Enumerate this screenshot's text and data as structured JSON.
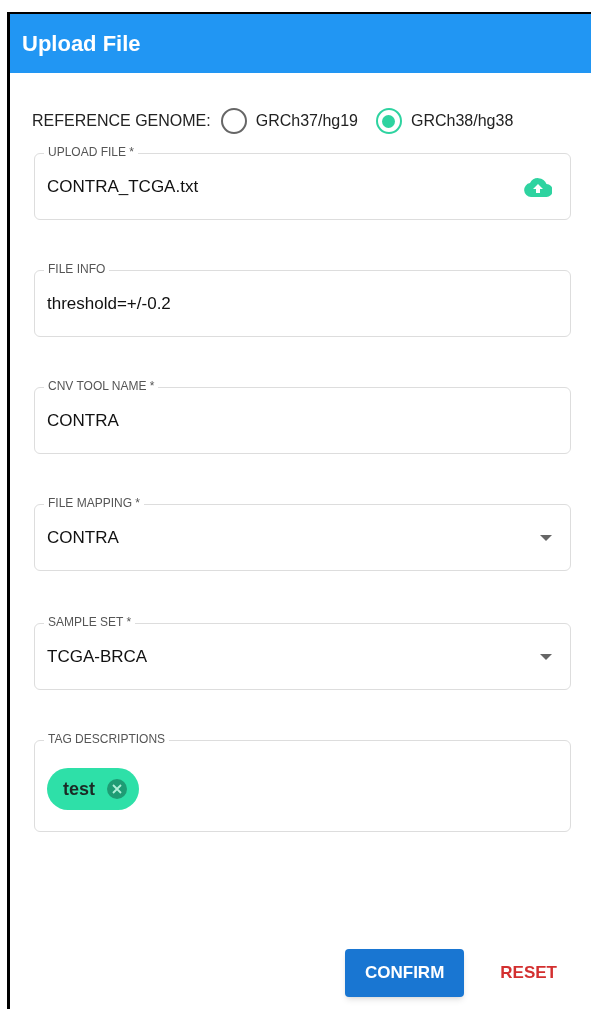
{
  "window": {
    "title": "Upload File"
  },
  "reference_genome": {
    "label": "REFERENCE GENOME:",
    "options": [
      {
        "label": "GRCh37/hg19",
        "selected": false
      },
      {
        "label": "GRCh38/hg38",
        "selected": true
      }
    ]
  },
  "fields": [
    {
      "kind": "file",
      "label": "UPLOAD FILE *",
      "value": "CONTRA_TCGA.txt"
    },
    {
      "kind": "text",
      "label": "FILE INFO",
      "value": "threshold=+/-0.2"
    },
    {
      "kind": "text",
      "label": "CNV TOOL NAME *",
      "value": "CONTRA"
    },
    {
      "kind": "select",
      "label": "FILE MAPPING *",
      "value": "CONTRA"
    },
    {
      "kind": "select",
      "label": "SAMPLE SET *",
      "value": "TCGA-BRCA"
    },
    {
      "kind": "tags",
      "label": "TAG DESCRIPTIONS",
      "tags": [
        "test"
      ]
    }
  ],
  "buttons": [
    {
      "kind": "primary",
      "label": "CONFIRM"
    },
    {
      "kind": "text",
      "label": "RESET"
    }
  ]
}
